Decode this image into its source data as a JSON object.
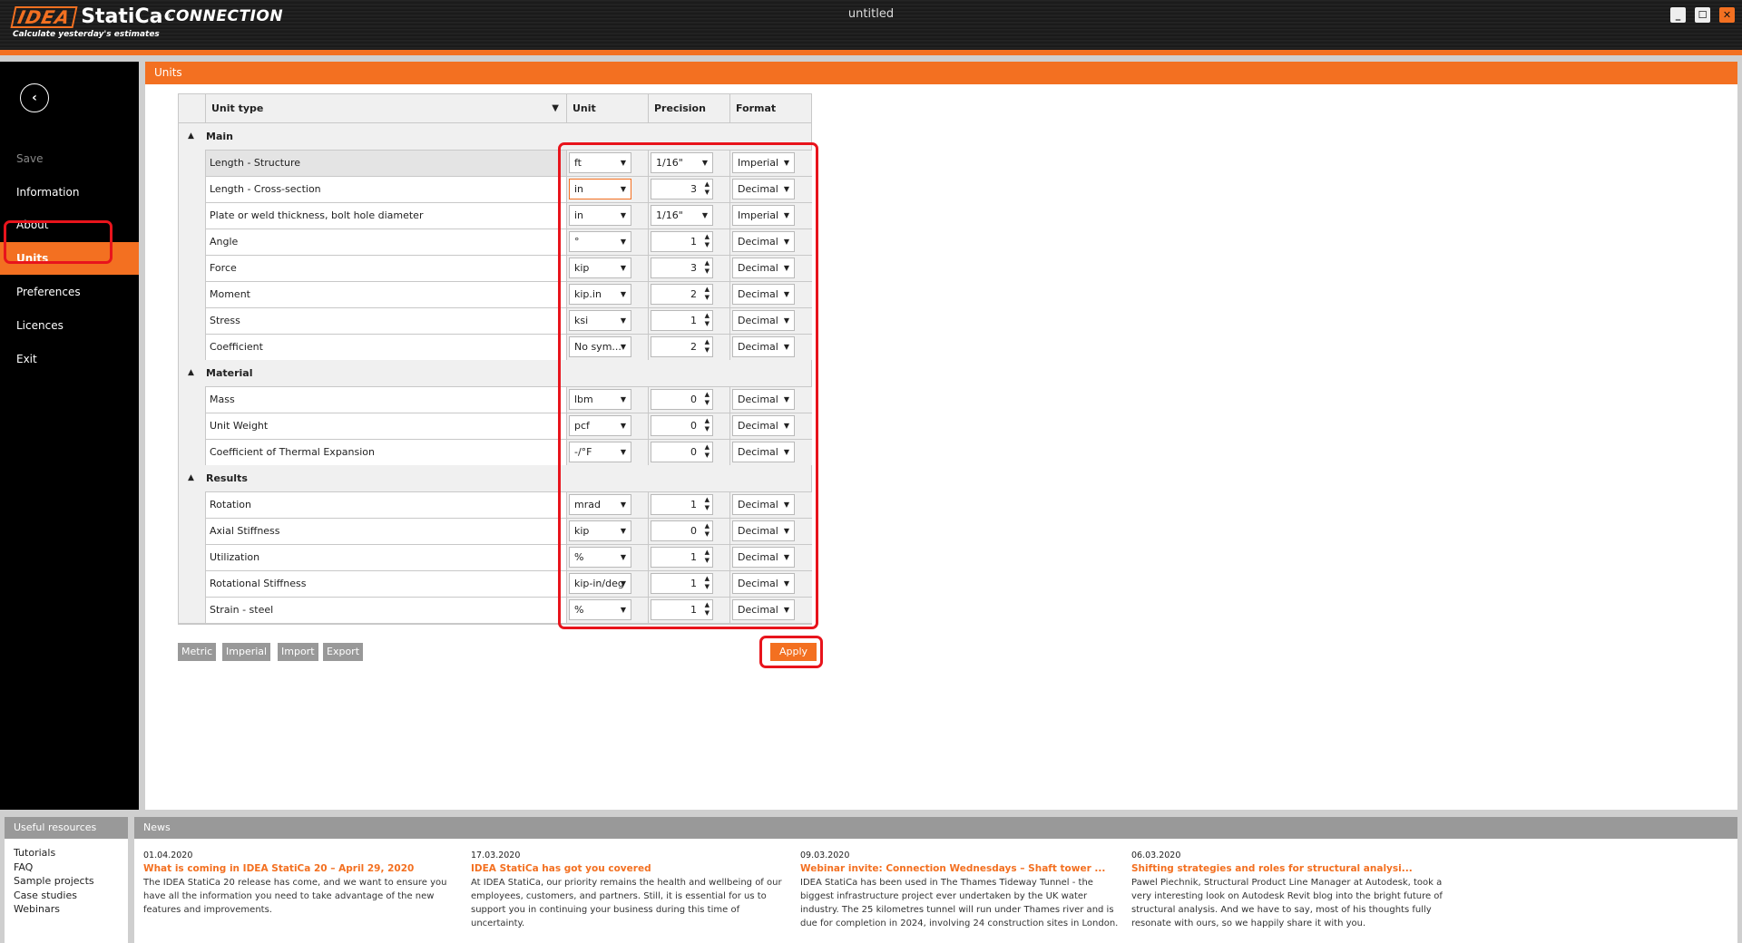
{
  "app": {
    "logo_brand": "IDEA",
    "logo_product": "StatiCa",
    "logo_reg": "®",
    "module": "CONNECTION",
    "tagline": "Calculate yesterday's estimates",
    "window_title": "untitled",
    "controls": {
      "minimize": "_",
      "maximize": "☐",
      "close": "✕"
    }
  },
  "colors": {
    "accent": "#f37021",
    "highlight": "#e8141c",
    "panel_header": "#999999"
  },
  "sidebar": {
    "back_icon": "‹",
    "items": [
      {
        "label": "Save",
        "state": "disabled"
      },
      {
        "label": "Information",
        "state": "normal"
      },
      {
        "label": "About",
        "state": "normal"
      },
      {
        "label": "Units",
        "state": "active"
      },
      {
        "label": "Preferences",
        "state": "normal"
      },
      {
        "label": "Licences",
        "state": "normal"
      },
      {
        "label": "Exit",
        "state": "normal"
      }
    ]
  },
  "content": {
    "header": "Units",
    "grid": {
      "columns": [
        "Unit type",
        "Unit",
        "Precision",
        "Format"
      ],
      "filter_icon": "▼",
      "groups": [
        {
          "label": "Main",
          "rows": [
            {
              "type": "Length - Structure",
              "unit": "ft",
              "precision": "1/16\"",
              "precision_kind": "select",
              "format": "Imperial",
              "selected": true
            },
            {
              "type": "Length - Cross-section",
              "unit": "in",
              "precision": "3",
              "precision_kind": "spin",
              "format": "Decimal",
              "focused": true
            },
            {
              "type": "Plate or weld thickness, bolt hole diameter",
              "unit": "in",
              "precision": "1/16\"",
              "precision_kind": "select",
              "format": "Imperial"
            },
            {
              "type": "Angle",
              "unit": "°",
              "precision": "1",
              "precision_kind": "spin",
              "format": "Decimal"
            },
            {
              "type": "Force",
              "unit": "kip",
              "precision": "3",
              "precision_kind": "spin",
              "format": "Decimal"
            },
            {
              "type": "Moment",
              "unit": "kip.in",
              "precision": "2",
              "precision_kind": "spin",
              "format": "Decimal"
            },
            {
              "type": "Stress",
              "unit": "ksi",
              "precision": "1",
              "precision_kind": "spin",
              "format": "Decimal"
            },
            {
              "type": "Coefficient",
              "unit": "No sym...",
              "precision": "2",
              "precision_kind": "spin",
              "format": "Decimal"
            }
          ]
        },
        {
          "label": "Material",
          "rows": [
            {
              "type": "Mass",
              "unit": "lbm",
              "precision": "0",
              "precision_kind": "spin",
              "format": "Decimal"
            },
            {
              "type": "Unit Weight",
              "unit": "pcf",
              "precision": "0",
              "precision_kind": "spin",
              "format": "Decimal"
            },
            {
              "type": "Coefficient of Thermal Expansion",
              "unit": "-/°F",
              "precision": "0",
              "precision_kind": "spin",
              "format": "Decimal"
            }
          ]
        },
        {
          "label": "Results",
          "rows": [
            {
              "type": "Rotation",
              "unit": "mrad",
              "precision": "1",
              "precision_kind": "spin",
              "format": "Decimal"
            },
            {
              "type": "Axial Stiffness",
              "unit": "kip",
              "precision": "0",
              "precision_kind": "spin",
              "format": "Decimal"
            },
            {
              "type": "Utilization",
              "unit": "%",
              "precision": "1",
              "precision_kind": "spin",
              "format": "Decimal"
            },
            {
              "type": "Rotational Stiffness",
              "unit": "kip-in/deg",
              "precision": "1",
              "precision_kind": "spin",
              "format": "Decimal"
            },
            {
              "type": "Strain - steel",
              "unit": "%",
              "precision": "1",
              "precision_kind": "spin",
              "format": "Decimal"
            }
          ]
        }
      ]
    },
    "buttons": {
      "metric": "Metric",
      "imperial": "Imperial",
      "import": "Import",
      "export": "Export",
      "apply": "Apply"
    }
  },
  "footer": {
    "resources": {
      "title": "Useful resources",
      "items": [
        "Tutorials",
        "FAQ",
        "Sample projects",
        "Case studies",
        "Webinars"
      ]
    },
    "news": {
      "title": "News",
      "items": [
        {
          "date": "01.04.2020",
          "title": "What is coming in IDEA StatiCa 20 – April 29, 2020",
          "body": "The IDEA StatiCa 20 release has come, and we want to ensure you have all the information you need to take advantage of the new features and improvements."
        },
        {
          "date": "17.03.2020",
          "title": "IDEA StatiCa has got you covered",
          "body": "At IDEA StatiCa, our priority remains the health and wellbeing of our employees, customers, and partners. Still, it is essential for us to support you in continuing your business during this time of uncertainty."
        },
        {
          "date": "09.03.2020",
          "title": "Webinar invite: Connection Wednesdays – Shaft tower ...",
          "body": "IDEA StatiCa has been used in The Thames Tideway Tunnel - the biggest infrastructure project ever undertaken by the UK water industry. The 25 kilometres tunnel will run under Thames river and is due for completion in 2024, involving 24 construction sites in London."
        },
        {
          "date": "06.03.2020",
          "title": "Shifting strategies and roles for structural analysi...",
          "body": "Pawel Piechnik, Structural Product Line Manager at Autodesk, took a very interesting look on Autodesk Revit blog into the bright future of structural analysis. And we have to say, most of his thoughts fully resonate with ours, so we happily share it with you."
        }
      ]
    }
  }
}
